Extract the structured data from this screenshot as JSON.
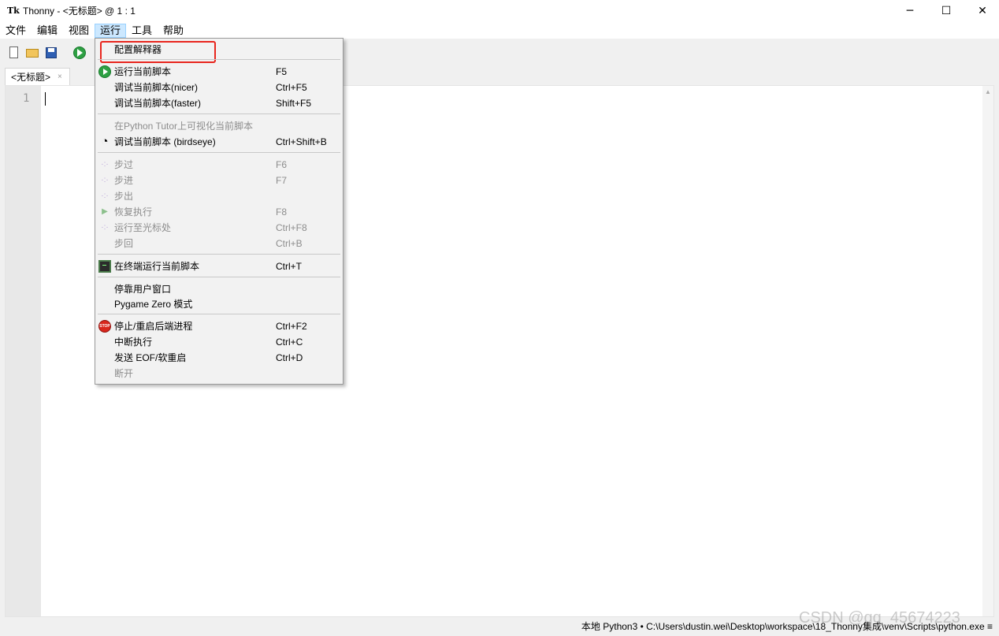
{
  "window": {
    "app_icon": "Tk",
    "title": "Thonny  -  <无标题>  @  1 : 1",
    "controls": [
      "─",
      "☐",
      "✕"
    ]
  },
  "menubar": [
    "文件",
    "编辑",
    "视图",
    "运行",
    "工具",
    "帮助"
  ],
  "menubar_active": "运行",
  "tabs": [
    {
      "label": "<无标题>",
      "close": "×"
    }
  ],
  "editor": {
    "line_numbers": [
      "1"
    ],
    "content": ""
  },
  "status": "本地 Python3  •  C:\\Users\\dustin.wei\\Desktop\\workspace\\18_Thonny集成\\venv\\Scripts\\python.exe  ≡",
  "watermark": "CSDN @qq_45674223",
  "run_menu": {
    "configure": {
      "label": "配置解释器",
      "highlighted": true
    },
    "items": [
      {
        "label": "运行当前脚本",
        "shortcut": "F5",
        "icon": "run-icon",
        "enabled": true
      },
      {
        "label": "调试当前脚本(nicer)",
        "shortcut": "Ctrl+F5",
        "enabled": true
      },
      {
        "label": "调试当前脚本(faster)",
        "shortcut": "Shift+F5",
        "enabled": true
      },
      {
        "label": "在Python Tutor上可视化当前脚本",
        "shortcut": "",
        "enabled": false
      },
      {
        "label": "调试当前脚本 (birdseye)",
        "shortcut": "Ctrl+Shift+B",
        "icon": "birdseye-icon",
        "enabled": true
      },
      {
        "label": "步过",
        "shortcut": "F6",
        "icon": "step-over-icon",
        "enabled": false
      },
      {
        "label": "步进",
        "shortcut": "F7",
        "icon": "step-into-icon",
        "enabled": false
      },
      {
        "label": "步出",
        "shortcut": "",
        "icon": "step-out-icon",
        "enabled": false
      },
      {
        "label": "恢复执行",
        "shortcut": "F8",
        "icon": "resume-icon",
        "enabled": false
      },
      {
        "label": "运行至光标处",
        "shortcut": "Ctrl+F8",
        "icon": "run-to-cursor-icon",
        "enabled": false
      },
      {
        "label": "步回",
        "shortcut": "Ctrl+B",
        "enabled": false
      },
      {
        "label": "在终端运行当前脚本",
        "shortcut": "Ctrl+T",
        "icon": "terminal-icon",
        "enabled": true
      },
      {
        "label": "停靠用户窗口",
        "shortcut": "",
        "enabled": true
      },
      {
        "label": "Pygame Zero 模式",
        "shortcut": "",
        "enabled": true
      },
      {
        "label": "停止/重启后端进程",
        "shortcut": "Ctrl+F2",
        "icon": "stop-icon",
        "enabled": true
      },
      {
        "label": "中断执行",
        "shortcut": "Ctrl+C",
        "enabled": true
      },
      {
        "label": "发送 EOF/软重启",
        "shortcut": "Ctrl+D",
        "enabled": true
      },
      {
        "label": "断开",
        "shortcut": "",
        "enabled": false
      }
    ],
    "stop_icon_text": "STOP",
    "step_glyph": "·:·",
    "resume_glyph": "▶"
  }
}
